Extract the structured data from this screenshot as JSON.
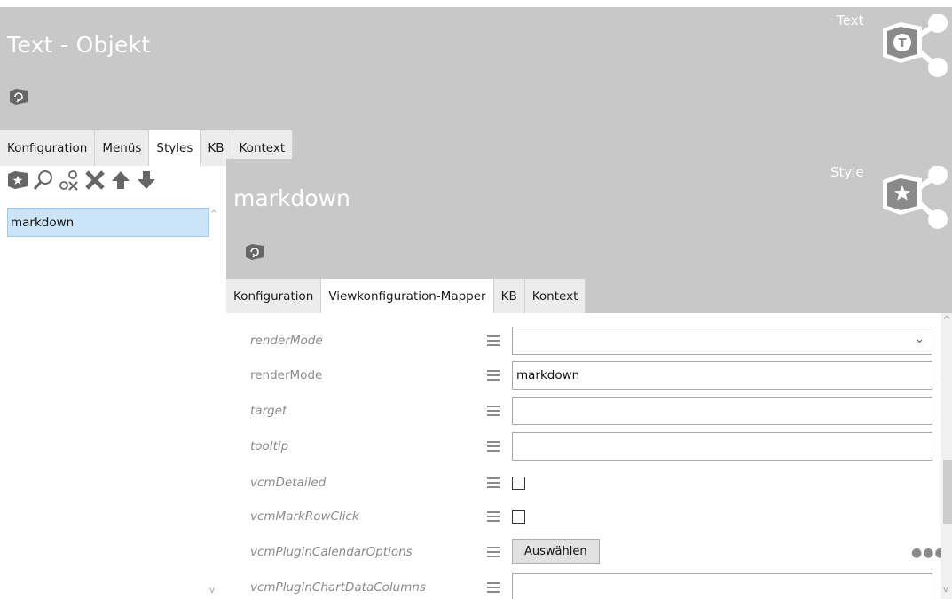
{
  "header": {
    "title": "Text - Objekt",
    "type_label": "Text",
    "type_icon": "text-object-type-icon",
    "small_icon": "object-refresh-icon"
  },
  "main_tabs": [
    {
      "label": "Konfiguration",
      "active": false
    },
    {
      "label": "Menüs",
      "active": false
    },
    {
      "label": "Styles",
      "active": true
    },
    {
      "label": "KB",
      "active": false
    },
    {
      "label": "Kontext",
      "active": false
    }
  ],
  "toolbar": {
    "icons": [
      "new-style-icon",
      "search-icon",
      "unlink-icon",
      "delete-icon",
      "move-up-icon",
      "move-down-icon"
    ]
  },
  "styles_list": {
    "items": [
      "markdown"
    ],
    "selected": "markdown"
  },
  "style_panel": {
    "title": "markdown",
    "type_label": "Style",
    "type_icon": "style-type-icon",
    "small_icon": "object-refresh-icon"
  },
  "sub_tabs": [
    {
      "label": "Konfiguration",
      "active": false
    },
    {
      "label": "Viewkonfiguration-Mapper",
      "active": true
    },
    {
      "label": "KB",
      "active": false
    },
    {
      "label": "Kontext",
      "active": false
    }
  ],
  "properties": [
    {
      "label": "renderMode",
      "italic": true,
      "control": "select",
      "value": ""
    },
    {
      "label": "renderMode",
      "italic": false,
      "control": "text",
      "value": "markdown"
    },
    {
      "label": "target",
      "italic": true,
      "control": "text",
      "value": ""
    },
    {
      "label": "tooltip",
      "italic": true,
      "control": "text",
      "value": ""
    },
    {
      "label": "vcmDetailed",
      "italic": true,
      "control": "checkbox",
      "checked": false
    },
    {
      "label": "vcmMarkRowClick",
      "italic": true,
      "control": "checkbox",
      "checked": false
    },
    {
      "label": "vcmPluginCalendarOptions",
      "italic": true,
      "control": "button",
      "button_label": "Auswählen",
      "more": "●●●"
    },
    {
      "label": "vcmPluginChartDataColumns",
      "italic": true,
      "control": "text",
      "value": ""
    }
  ],
  "colors": {
    "header_bg": "#c8c8c8",
    "selection_bg": "#cce4f7",
    "label_gray": "#8a8a8a"
  }
}
